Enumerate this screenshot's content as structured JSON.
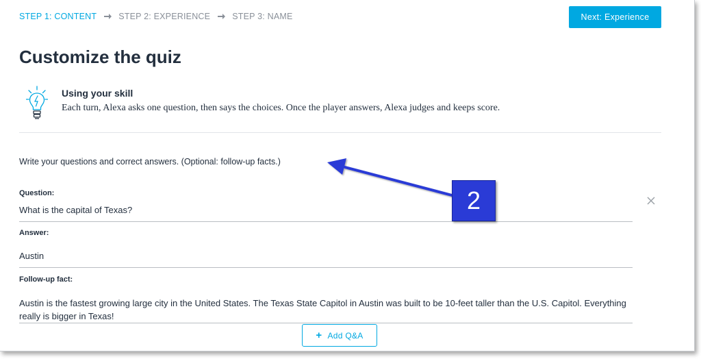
{
  "steps": [
    {
      "label": "STEP 1: CONTENT"
    },
    {
      "label": "STEP 2: EXPERIENCE"
    },
    {
      "label": "STEP 3: NAME"
    }
  ],
  "next_button": "Next: Experience",
  "title": "Customize the quiz",
  "info": {
    "title": "Using your skill",
    "text": "Each turn, Alexa asks one question, then says the choices. Once the player answers, Alexa judges and keeps score."
  },
  "instructions": "Write your questions and correct answers. (Optional: follow-up facts.)",
  "qa": {
    "question_label": "Question:",
    "question_value": "What is the capital of Texas?",
    "answer_label": "Answer:",
    "answer_value": "Austin",
    "fact_label": "Follow-up fact:",
    "fact_value": "Austin is the fastest growing large city in the United States. The Texas State Capitol in Austin was built to be 10-feet taller than the U.S. Capitol. Everything really is bigger in Texas!"
  },
  "add_button": "Add Q&A",
  "annotation": {
    "number": "2"
  },
  "colors": {
    "accent": "#00a8e1",
    "text": "#232f3e",
    "muted": "#8a9099",
    "callout": "#2a3bd6"
  },
  "icons": [
    "arrow-right-icon",
    "lightbulb-icon",
    "close-icon",
    "plus-icon"
  ]
}
